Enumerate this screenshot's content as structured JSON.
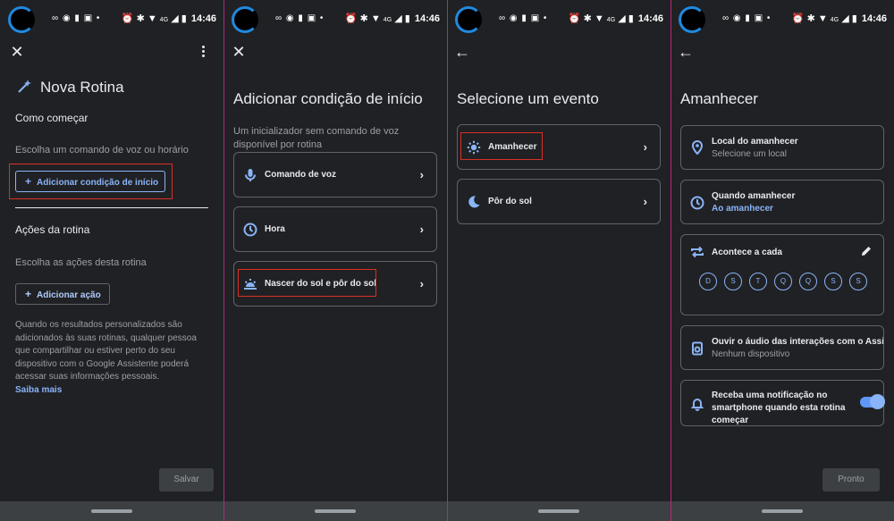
{
  "status_bar": {
    "network": "4G",
    "time": "14:46"
  },
  "screen1": {
    "title": "Nova Rotina",
    "how_to_start": "Como começar",
    "choose_hint": "Escolha um comando de voz ou horário",
    "add_start_condition": "Adicionar condição de início",
    "routine_actions": "Ações da rotina",
    "actions_hint": "Escolha as ações desta rotina",
    "add_action": "Adicionar ação",
    "info_text": "Quando os resultados personalizados são adicionados às suas rotinas, qualquer pessoa que compartilhar ou estiver perto do seu dispositivo com o Google Assistente poderá acessar suas informações pessoais.",
    "learn_more": "Saiba mais",
    "save": "Salvar"
  },
  "screen2": {
    "title": "Adicionar condição de início",
    "subtitle": "Um inicializador sem comando de voz disponível por rotina",
    "options": [
      {
        "label": "Comando de voz",
        "icon": "mic-icon"
      },
      {
        "label": "Hora",
        "icon": "clock-icon"
      },
      {
        "label": "Nascer do sol e pôr do sol",
        "icon": "sunrise-icon"
      }
    ]
  },
  "screen3": {
    "title": "Selecione um evento",
    "options": [
      {
        "label": "Amanhecer",
        "icon": "sun-icon"
      },
      {
        "label": "Pôr do sol",
        "icon": "moon-icon"
      }
    ]
  },
  "screen4": {
    "title": "Amanhecer",
    "location": {
      "label": "Local do amanhecer",
      "value": "Selecione um local"
    },
    "when": {
      "label": "Quando amanhecer",
      "value": "Ao amanhecer"
    },
    "repeat": {
      "label": "Acontece a cada",
      "days": [
        "D",
        "S",
        "T",
        "Q",
        "Q",
        "S",
        "S"
      ]
    },
    "audio": {
      "label": "Ouvir o áudio das interações com o Assi...",
      "value": "Nenhum dispositivo"
    },
    "notify": {
      "label": "Receba uma notificação no smartphone quando esta rotina começar",
      "enabled": true
    },
    "done": "Pronto"
  },
  "colors": {
    "background": "#202124",
    "accent": "#8ab4f8",
    "highlight": "#d93025",
    "divider": "#b5287a"
  }
}
